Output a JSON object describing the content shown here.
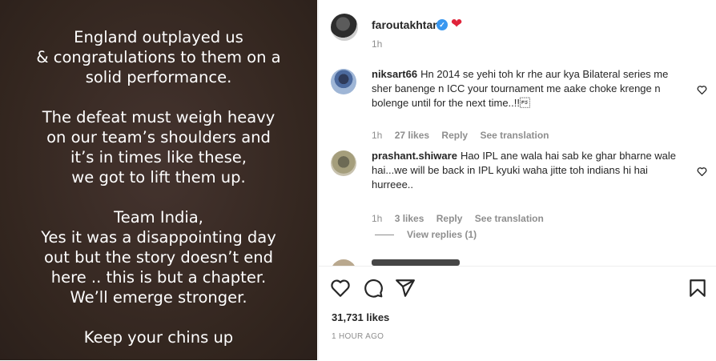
{
  "post": {
    "paragraphs": [
      [
        "England outplayed us",
        "& congratulations to them on a",
        "solid performance."
      ],
      [
        "The defeat must weigh heavy",
        "on our team’s shoulders and",
        "it’s in times like these,",
        "we got to lift them up."
      ],
      [
        "Team India,",
        "Yes it was a disappointing day",
        "out but the story doesn’t end",
        "here .. this is but a chapter.",
        "We’ll emerge stronger."
      ],
      [
        "Keep your chins up"
      ]
    ]
  },
  "header": {
    "username": "faroutakhtar",
    "time": "1h",
    "verified_symbol": "✓",
    "emoji": "❤"
  },
  "comments": [
    {
      "username": "niksart66",
      "text": "Hn 2014 se yehi toh kr rhe aur kya Bilateral series me sher banenge n ICC your tournament me aake choke krenge n bolenge until for the next time..!!\u001c",
      "time": "1h",
      "likes": "27 likes",
      "reply": "Reply",
      "translate": "See translation"
    },
    {
      "username": "prashant.shiware",
      "text": "Hao IPL ane wala hai sab ke ghar bharne wale hai...we will be back in IPL kyuki waha jitte toh indians hi hai hurreee..",
      "time": "1h",
      "likes": "3 likes",
      "reply": "Reply",
      "translate": "See translation"
    }
  ],
  "view_replies": "View replies (1)",
  "footer": {
    "likes": "31,731 likes",
    "time": "1 HOUR AGO"
  },
  "colors": {
    "post_bg": "#3a2c28",
    "verified": "#3897f0",
    "heart": "#e0243a",
    "muted": "#8e8e8e"
  }
}
